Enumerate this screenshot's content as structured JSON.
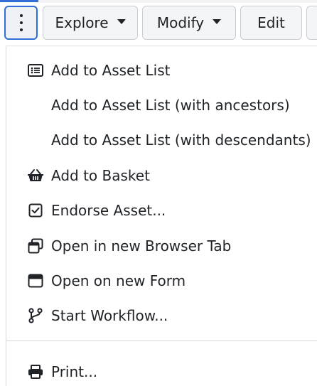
{
  "toolbar": {
    "kebab_icon": "kebab-vertical-icon",
    "buttons": [
      {
        "label": "Explore",
        "icon": "caret-down-icon"
      },
      {
        "label": "Modify",
        "icon": "caret-down-icon"
      },
      {
        "label": "Edit"
      }
    ]
  },
  "menu": {
    "items": [
      {
        "label": "Add to Asset List",
        "icon": "list-icon"
      },
      {
        "label": "Add to Asset List (with ancestors)",
        "icon": ""
      },
      {
        "label": "Add to Asset List (with descendants)",
        "icon": ""
      },
      {
        "label": "Add to Basket",
        "icon": "basket-icon"
      },
      {
        "label": "Endorse Asset...",
        "icon": "checkbox-icon"
      },
      {
        "label": "Open in new Browser Tab",
        "icon": "new-tab-icon"
      },
      {
        "label": "Open on new Form",
        "icon": "window-icon"
      },
      {
        "label": "Start Workflow...",
        "icon": "workflow-branch-icon"
      }
    ],
    "footer_items": [
      {
        "label": "Print...",
        "icon": "printer-icon"
      }
    ]
  },
  "colors": {
    "accent": "#2f6fd6",
    "button_bg": "#f4f5f7",
    "border": "#c9ccd1",
    "text": "#1f2328"
  }
}
